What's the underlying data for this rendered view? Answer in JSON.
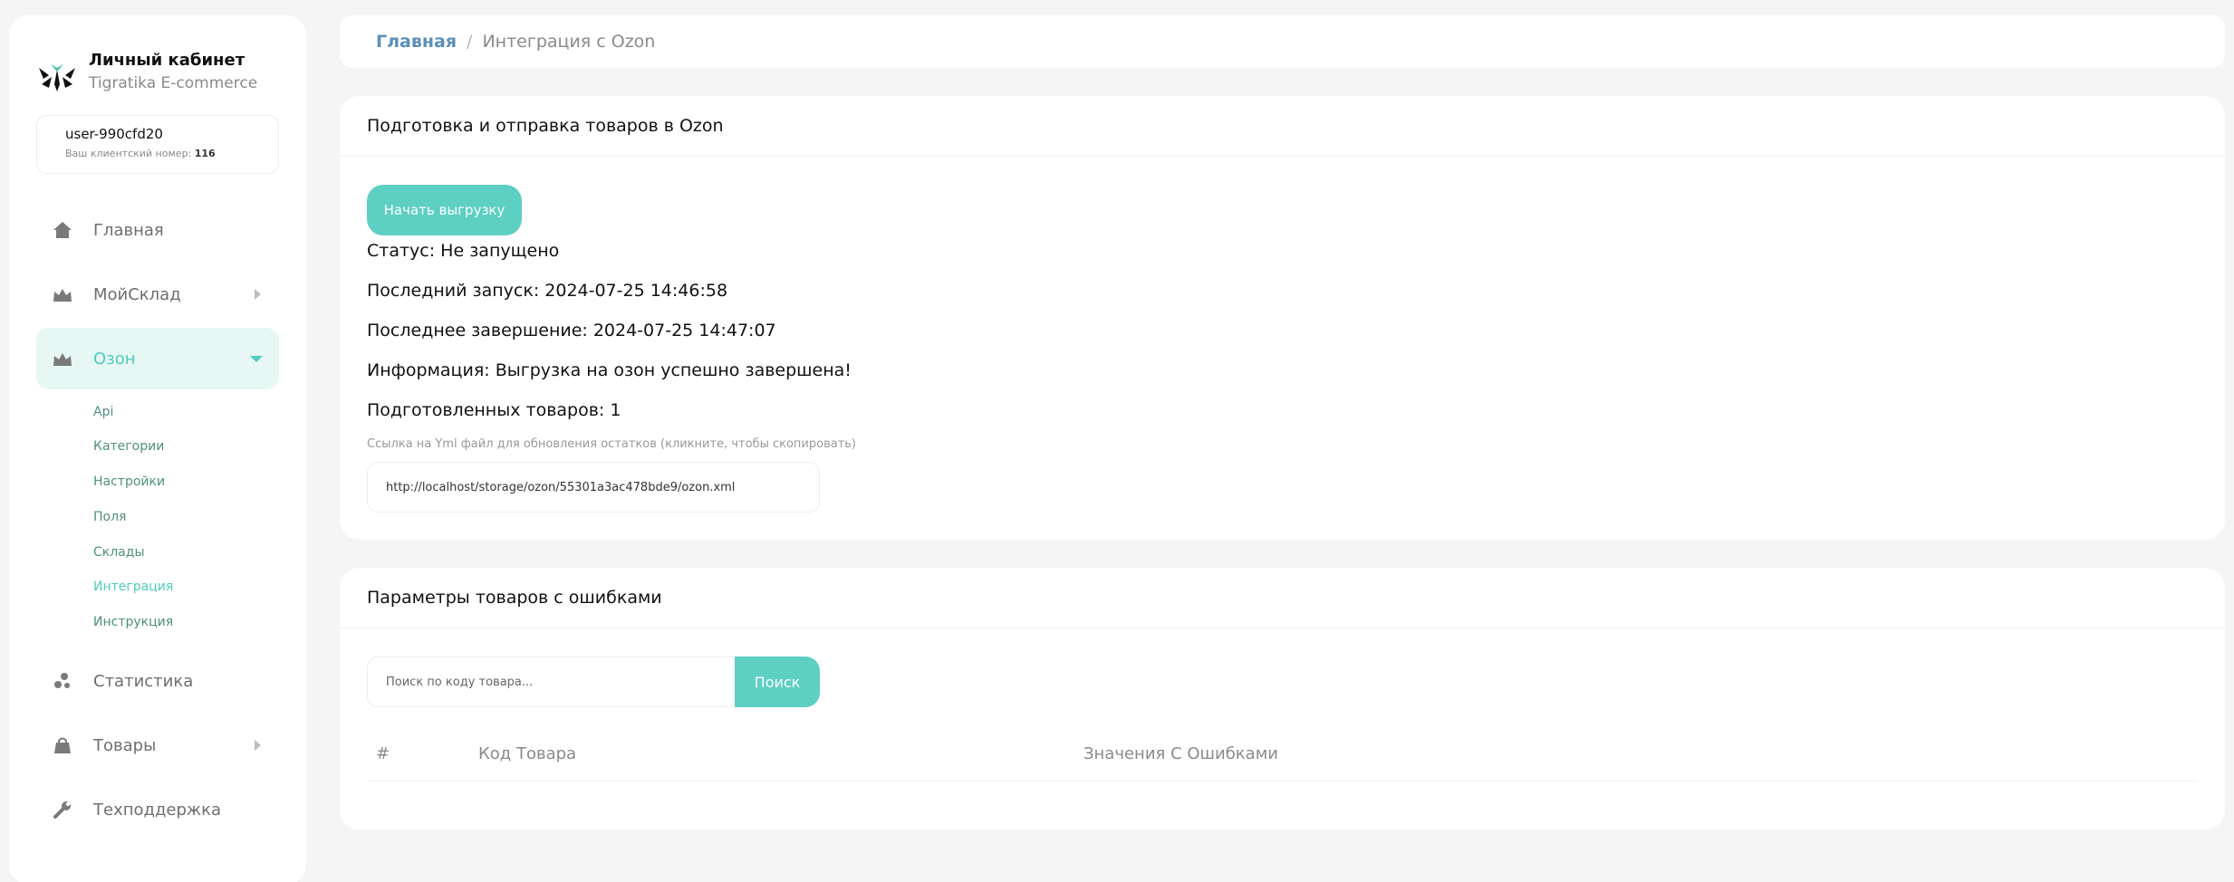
{
  "brand": {
    "title": "Личный кабинет",
    "subtitle": "Tigratika E-commerce",
    "logo_icon": "tigratika-logo-icon"
  },
  "user": {
    "name": "user-990cfd20",
    "client_label": "Ваш клиентский номер:",
    "client_number": "116"
  },
  "colors": {
    "accent": "#5dcfc3",
    "active_bg": "#e6f7f4",
    "breadcrumb_link": "#5b8fb9",
    "subnav_text": "#4f8f7f"
  },
  "sidebar": {
    "items": [
      {
        "label": "Главная",
        "icon": "home-icon",
        "expandable": false,
        "active": false
      },
      {
        "label": "МойСклад",
        "icon": "crown-icon",
        "expandable": true,
        "active": false
      },
      {
        "label": "Озон",
        "icon": "crown-icon",
        "expandable": true,
        "active": true,
        "expanded": true
      },
      {
        "label": "Статистика",
        "icon": "stats-icon",
        "expandable": false,
        "active": false
      },
      {
        "label": "Товары",
        "icon": "bag-icon",
        "expandable": true,
        "active": false
      },
      {
        "label": "Техподдержка",
        "icon": "wrench-icon",
        "expandable": false,
        "active": false
      }
    ],
    "ozon_submenu": [
      {
        "label": "Api",
        "active": false
      },
      {
        "label": "Категории",
        "active": false
      },
      {
        "label": "Настройки",
        "active": false
      },
      {
        "label": "Поля",
        "active": false
      },
      {
        "label": "Склады",
        "active": false
      },
      {
        "label": "Интеграция",
        "active": true
      },
      {
        "label": "Инструкция",
        "active": false
      }
    ]
  },
  "breadcrumb": {
    "home": "Главная",
    "separator": "/",
    "current": "Интеграция с Ozon"
  },
  "export_card": {
    "title": "Подготовка и отправка товаров в Ozon",
    "start_button": "Начать выгрузку",
    "status": "Статус: Не запущено",
    "last_run": "Последний запуск: 2024-07-25 14:46:58",
    "last_finish": "Последнее завершение: 2024-07-25 14:47:07",
    "info": "Информация: Выгрузка на озон успешно завершена!",
    "prepared": "Подготовленных товаров: 1",
    "link_caption": "Ссылка на Yml файл для обновления остатков (кликните, чтобы скопировать)",
    "link_url": "http://localhost/storage/ozon/55301a3ac478bde9/ozon.xml"
  },
  "errors_card": {
    "title": "Параметры товаров с ошибками",
    "search_placeholder": "Поиск по коду товара...",
    "search_button": "Поиск",
    "columns": [
      "#",
      "Код Товара",
      "Значения С Ошибками"
    ],
    "rows": []
  }
}
